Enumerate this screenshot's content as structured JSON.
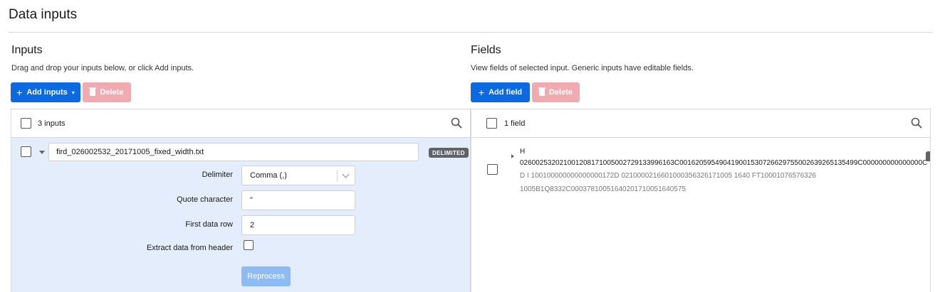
{
  "page": {
    "title": "Data inputs"
  },
  "inputs": {
    "title": "Inputs",
    "description": "Drag and drop your inputs below, or click Add inputs.",
    "add_label": "Add inputs",
    "delete_label": "Delete",
    "count_label": "3 inputs",
    "selected": {
      "filename": "fird_026002532_20171005_fixed_width.txt",
      "badge": "DELIMITED",
      "delimiter_label": "Delimiter",
      "delimiter_value": "Comma (,)",
      "quote_label": "Quote character",
      "quote_value": "\"",
      "first_row_label": "First data row",
      "first_row_value": "2",
      "extract_label": "Extract data from header",
      "extract_checked": false,
      "reprocess_label": "Reprocess"
    }
  },
  "fields": {
    "title": "Fields",
    "description": "View fields of selected input. Generic inputs have editable fields.",
    "add_label": "Add field",
    "delete_label": "Delete",
    "count_label": "1 field",
    "items": [
      {
        "name": "H",
        "value": "026002532021001208171005002729133996163C0016205954904190015307266297550026392651354​99C000000000000000C",
        "sample_line1": "D I 100100000000000000172D 021000021660100035632617​1005 1640 FT10001076576326",
        "sample_line2": "1005B1Q8332C000378100516402017100516405​75"
      }
    ]
  },
  "icons": {
    "search": "search-icon",
    "add": "plus-icon",
    "delete": "trash-icon",
    "expand": "chevron-down-icon",
    "tree": "caret-right-icon"
  },
  "colors": {
    "primary": "#0b6ae2",
    "danger_disabled": "#f2aab1",
    "selected_row": "#e3edfb",
    "badge": "#5f6368",
    "reprocess_disabled": "#8dbbf3"
  }
}
